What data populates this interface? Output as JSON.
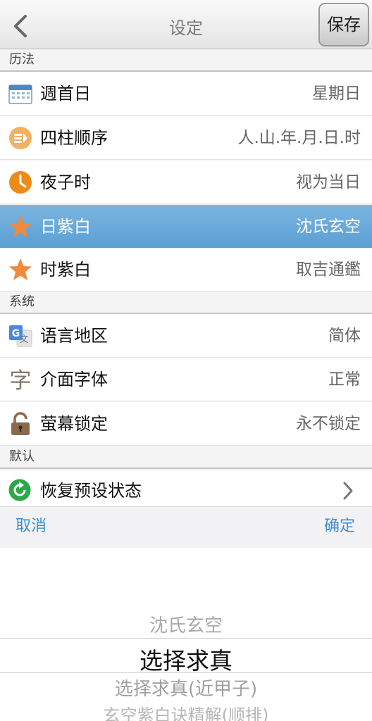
{
  "nav": {
    "title": "设定",
    "save_label": "保存"
  },
  "sections": {
    "calendar": "历法",
    "system": "系统",
    "default": "默认"
  },
  "calendar_rows": [
    {
      "label": "週首日",
      "value": "星期日",
      "icon": "calendar-icon"
    },
    {
      "label": "四柱顺序",
      "value": "人.山.年.月.日.时",
      "icon": "order-icon"
    },
    {
      "label": "夜子时",
      "value": "视为当日",
      "icon": "clock-icon"
    },
    {
      "label": "日紫白",
      "value": "沈氏玄空",
      "icon": "star-icon",
      "selected": true
    },
    {
      "label": "时紫白",
      "value": "取吉通鑑",
      "icon": "star-icon"
    }
  ],
  "system_rows": [
    {
      "label": "语言地区",
      "value": "简体",
      "icon": "translate-icon"
    },
    {
      "label": "介面字体",
      "value": "正常",
      "icon": "font-icon"
    },
    {
      "label": "萤幕锁定",
      "value": "永不锁定",
      "icon": "lock-icon"
    }
  ],
  "default_rows": [
    {
      "label": "恢复预设状态",
      "icon": "refresh-icon"
    }
  ],
  "picker": {
    "cancel_label": "取消",
    "confirm_label": "确定",
    "options": [
      "沈氏玄空",
      "选择求真",
      "选择求真(近甲子)",
      "玄空紫白诀精解(顺排)"
    ],
    "selected": "选择求真"
  },
  "colors": {
    "accent": "#3a8fd6",
    "selected_row": "#6aaadb",
    "star": "#f08a3c",
    "clock": "#ee8a1a",
    "refresh": "#2aa84a"
  }
}
